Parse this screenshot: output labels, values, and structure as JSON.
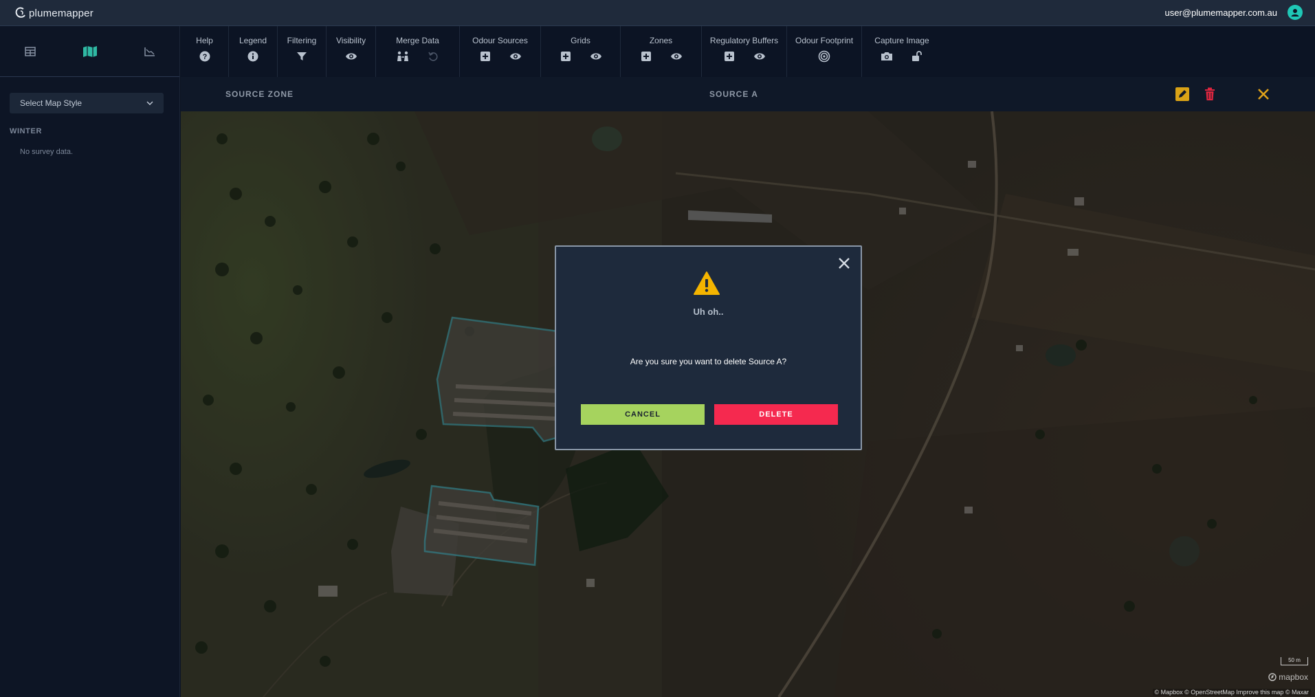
{
  "app": {
    "logo_text": "plumemapper",
    "user_email": "user@plumemapper.com.au"
  },
  "sidebar": {
    "view_tabs": [
      {
        "icon": "table-icon"
      },
      {
        "icon": "map-icon",
        "active": true
      },
      {
        "icon": "chart-icon"
      }
    ],
    "map_style_placeholder": "Select Map Style",
    "section_label": "WINTER",
    "empty_text": "No survey data."
  },
  "toolbar": {
    "help": "Help",
    "legend": "Legend",
    "filtering": "Filtering",
    "visibility": "Visibility",
    "merge_data": "Merge Data",
    "odour_sources": "Odour Sources",
    "grids": "Grids",
    "zones": "Zones",
    "regulatory_buffers": "Regulatory Buffers",
    "odour_footprint": "Odour Footprint",
    "capture_image": "Capture Image"
  },
  "subheader": {
    "left": "SOURCE ZONE",
    "center": "SOURCE A"
  },
  "map": {
    "scale": "50 m",
    "mapbox": "mapbox",
    "attribution": "© Mapbox © OpenStreetMap Improve this map © Maxar"
  },
  "modal": {
    "title": "Uh oh..",
    "message": "Are you sure you want to delete Source A?",
    "cancel": "CANCEL",
    "delete": "DELETE"
  },
  "colors": {
    "accent": "#1fc7b6",
    "edit": "#d9a216",
    "trash": "#e0263f",
    "close": "#e0a21a",
    "cancel": "#a6d35e",
    "delete": "#f5294f",
    "warning": "#f4b400"
  }
}
